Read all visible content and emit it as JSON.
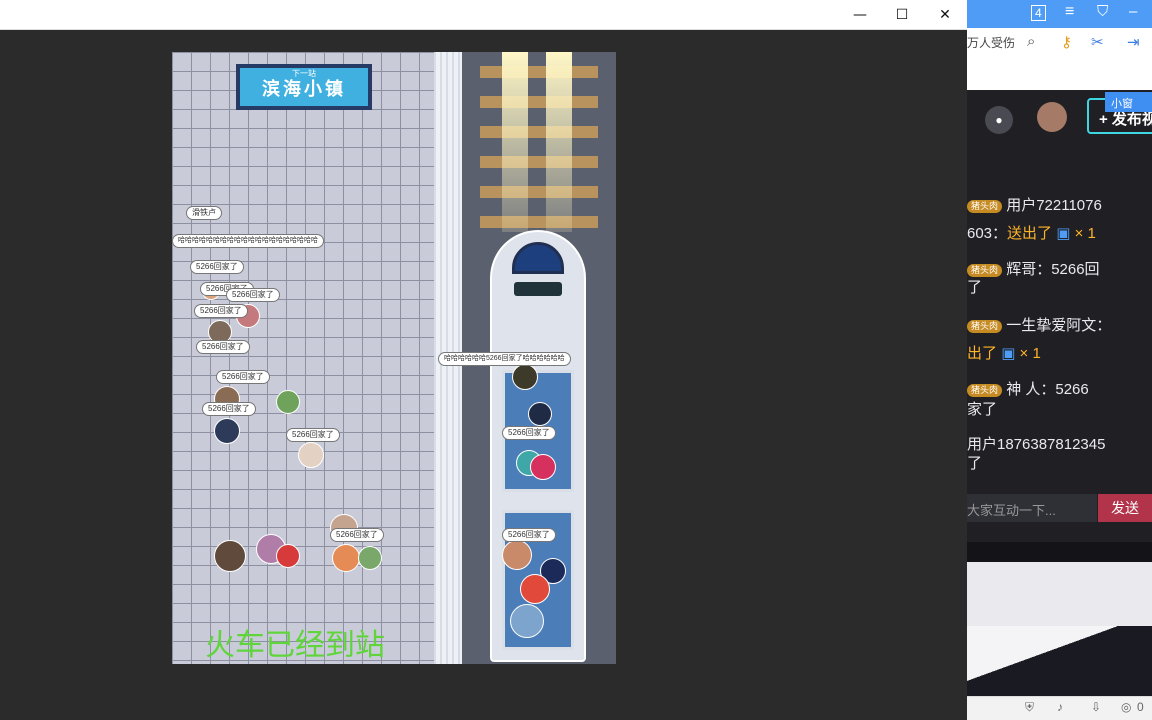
{
  "window": {
    "minimize": "—",
    "maximize": "☐",
    "close": "✕"
  },
  "station_sign": {
    "subtitle": "下一站",
    "name": "滨海小镇"
  },
  "status_text": "火车已经到站",
  "bubbles": [
    "滑铁卢",
    "哈哈哈哈哈哈哈哈哈哈哈哈哈哈哈哈哈哈哈哈",
    "5266回家了",
    "5266回家了",
    "5266回家了",
    "5266回家了",
    "5266回家了",
    "5266回家了",
    "5266回家了",
    "5266回家了",
    "哈哈哈哈哈哈5266回家了哈哈哈哈哈哈",
    "5266回家了",
    "5266回家了",
    "5266回家了"
  ],
  "right_panel": {
    "search_hint": "万人受伤",
    "publish_button": "+ 发布视",
    "mini_button": "小窗",
    "messages": [
      {
        "badge": "猪头肉",
        "text": "用户72211076"
      },
      {
        "text": "603：",
        "highlight": "送出了",
        "suffix": " × 1"
      },
      {
        "badge": "猪头肉",
        "text": "辉哥：5266回"
      },
      {
        "text": "了"
      },
      {
        "badge": "猪头肉",
        "text": "一生挚爱阿文："
      },
      {
        "text": "出了",
        "suffix": " × 1"
      },
      {
        "badge": "猪头肉",
        "text": "神 人：5266"
      },
      {
        "text": "家了"
      },
      {
        "text": "用户1876387812345"
      },
      {
        "text": "了"
      }
    ],
    "input_placeholder": "大家互动一下...",
    "send_button": "发送",
    "tray_count": "0"
  },
  "colors": {
    "accent": "#4f9cf7",
    "send": "#b2344a",
    "gift": "#ffb429",
    "arrived": "#5fd53a"
  }
}
